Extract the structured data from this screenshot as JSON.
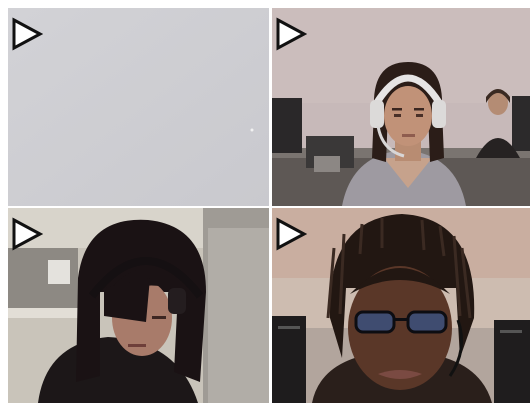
{
  "video_grid": {
    "tiles": [
      {
        "id": "tile-1",
        "play_icon": "play-triangle-icon"
      },
      {
        "id": "tile-2",
        "play_icon": "play-triangle-icon"
      },
      {
        "id": "tile-3",
        "play_icon": "play-triangle-icon"
      },
      {
        "id": "tile-4",
        "play_icon": "play-triangle-icon"
      }
    ]
  },
  "colors": {
    "play_icon_fill": "#ffffff",
    "play_icon_stroke": "#111111",
    "blank_feed": "#d6d6da"
  }
}
